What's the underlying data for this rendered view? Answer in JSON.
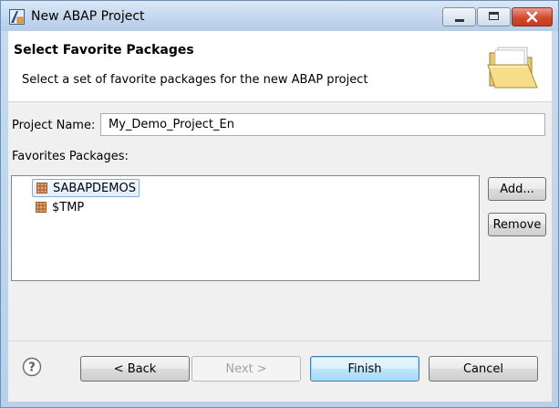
{
  "window": {
    "title": "New ABAP Project",
    "controls": [
      "minimize",
      "maximize",
      "close"
    ]
  },
  "banner": {
    "title": "Select Favorite Packages",
    "description": "Select a set of favorite packages for the new ABAP project",
    "icon": "folder-open-icon"
  },
  "form": {
    "project_name_label": "Project Name:",
    "project_name_value": "My_Demo_Project_En",
    "favorites_label": "Favorites Packages:"
  },
  "packages": [
    {
      "name": "SABAPDEMOS",
      "selected": true,
      "icon": "package-icon"
    },
    {
      "name": "$TMP",
      "selected": false,
      "icon": "package-icon"
    }
  ],
  "side_buttons": {
    "add": "Add...",
    "remove": "Remove"
  },
  "footer": {
    "help_icon": "help-icon",
    "back": "< Back",
    "next": "Next >",
    "finish": "Finish",
    "cancel": "Cancel"
  },
  "colors": {
    "titlebar": "#c2d6ed",
    "close_button": "#d2492f",
    "selection": "#e2eefb",
    "default_button": "#bee6fd"
  }
}
